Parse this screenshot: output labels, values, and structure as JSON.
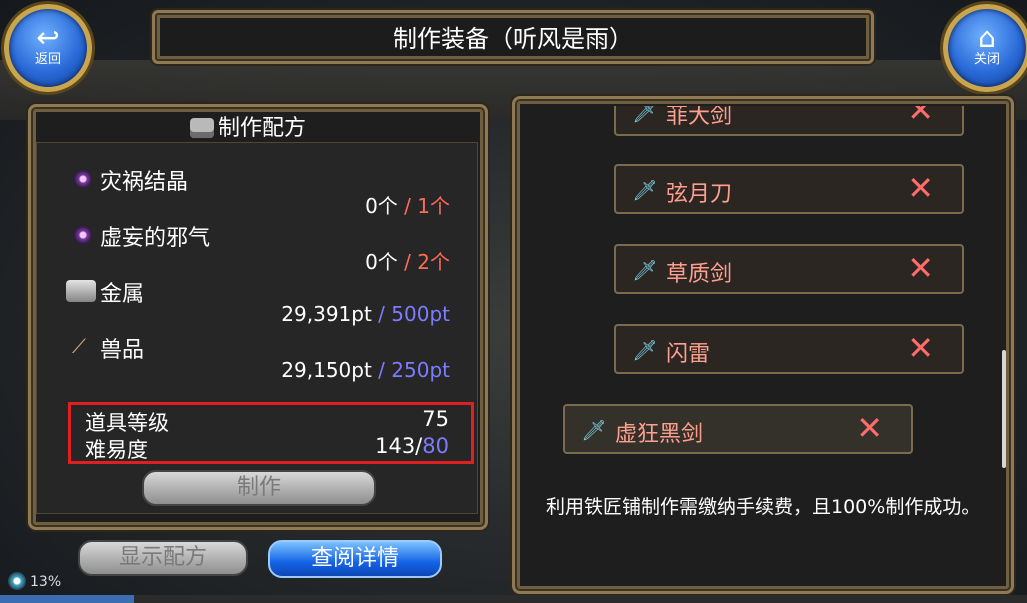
{
  "header": {
    "title": "制作装备（听风是雨）",
    "back_label": "返回",
    "close_label": "关闭"
  },
  "recipe": {
    "heading": "制作配方",
    "materials": [
      {
        "name": "灾祸结晶",
        "have": "0个",
        "sep": " / ",
        "need": "1个",
        "icon": "crystal-icon"
      },
      {
        "name": "虚妄的邪气",
        "have": "0个",
        "sep": " / ",
        "need": "2个",
        "icon": "crystal-icon"
      },
      {
        "name": "金属",
        "have": "29,391pt",
        "sep": " / ",
        "need": "500pt",
        "icon": "metal-icon"
      },
      {
        "name": "兽品",
        "have": "29,150pt",
        "sep": " / ",
        "need": "250pt",
        "icon": "fang-icon"
      }
    ],
    "stats": {
      "item_level_label": "道具等级",
      "item_level_value": "75",
      "difficulty_label": "难易度",
      "difficulty_have": "143/",
      "difficulty_need": "80"
    },
    "craft_button": "制作"
  },
  "buttons": {
    "show_recipe": "显示配方",
    "view_details": "查阅详情"
  },
  "list": {
    "items": [
      {
        "name": "菲大剑"
      },
      {
        "name": "弦月刀"
      },
      {
        "name": "草质剑"
      },
      {
        "name": "闪雷"
      },
      {
        "name": "虚狂黑剑"
      }
    ],
    "remove_symbol": "✕"
  },
  "description": "利用铁匠铺制作需缴纳手续费，且100%制作成功。",
  "status": {
    "progress_text": "13%",
    "progress": 0.13
  },
  "colors": {
    "need_red": "#ff6b55",
    "need_blue": "#7c7cff",
    "item_text": "#ffa08e",
    "highlight": "#e02020"
  }
}
